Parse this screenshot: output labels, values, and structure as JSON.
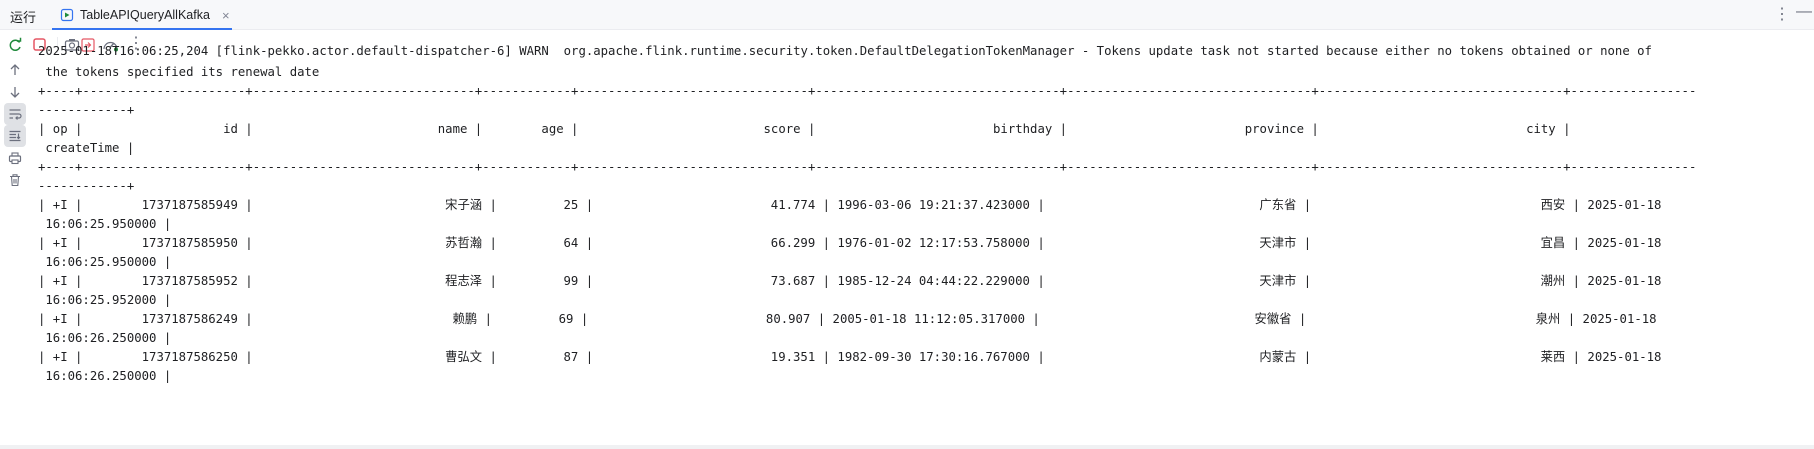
{
  "run_panel": {
    "title": "运行",
    "tab": {
      "label": "TableAPIQueryAllKafka",
      "close_glyph": "×",
      "icon": "run-config-icon"
    },
    "more_glyph": "⋮",
    "minimize_glyph": "—"
  },
  "toolbar": {
    "buttons": [
      "rerun-icon",
      "stop-icon",
      "screenshot-icon",
      "restore-layout-icon",
      "profiler-icon",
      "more-icon"
    ],
    "more_glyph": "⋮"
  },
  "gutter": {
    "buttons": [
      "up-arrow-icon",
      "down-arrow-icon",
      "soft-wrap-icon",
      "scroll-to-end-icon",
      "print-icon",
      "clear-icon"
    ]
  },
  "console": {
    "lines": [
      "2025-01-18T16:06:25,204 [flink-pekko.actor.default-dispatcher-6] WARN  org.apache.flink.runtime.security.token.DefaultDelegationTokenManager - Tokens update task not started because either no tokens obtained or none of",
      " the tokens specified its renewal date",
      "+----+----------------------+------------------------------+------------+-------------------------------+---------------------------------+---------------------------------+---------------------------------+-----------------",
      "------------+",
      "| op |                   id |                         name |        age |                         score |                        birthday |                        province |                            city |",
      " createTime |",
      "+----+----------------------+------------------------------+------------+-------------------------------+---------------------------------+---------------------------------+---------------------------------+-----------------",
      "------------+",
      "| +I |        1737187585949 |                          宋子涵 |         25 |                        41.774 | 1996-03-06 19:21:37.423000 |                             广东省 |                               西安 | 2025-01-18",
      " 16:06:25.950000 |",
      "| +I |        1737187585950 |                          苏哲瀚 |         64 |                        66.299 | 1976-01-02 12:17:53.758000 |                             天津市 |                               宜昌 | 2025-01-18",
      " 16:06:25.950000 |",
      "| +I |        1737187585952 |                          程志泽 |         99 |                        73.687 | 1985-12-24 04:44:22.229000 |                             天津市 |                               潮州 | 2025-01-18",
      " 16:06:25.952000 |",
      "| +I |        1737187586249 |                           赖鹏 |         69 |                        80.907 | 2005-01-18 11:12:05.317000 |                             安徽省 |                               泉州 | 2025-01-18",
      " 16:06:26.250000 |",
      "| +I |        1737187586250 |                          曹弘文 |         87 |                        19.351 | 1982-09-30 17:30:16.767000 |                             内蒙古 |                               莱西 | 2025-01-18",
      " 16:06:26.250000 |"
    ]
  },
  "colors": {
    "accent": "#3574f0",
    "stop": "#e55765",
    "rerun": "#208a3c",
    "text": "#1e1f22"
  }
}
